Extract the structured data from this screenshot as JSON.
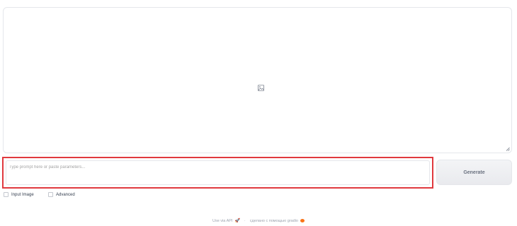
{
  "output": {
    "image_icon": "image-placeholder-icon",
    "resize_icon": "resize-handle-icon"
  },
  "prompt": {
    "placeholder": "Type prompt here or paste parameters..."
  },
  "generate": {
    "label": "Generate"
  },
  "options": {
    "input_image_label": "Input Image",
    "advanced_label": "Advanced"
  },
  "footer": {
    "api_label": "Use via API",
    "separator": "·",
    "made_with": "сделано с помощью gradio",
    "api_icon": "rocket-icon",
    "gradio_icon": "gradio-logo-icon"
  },
  "colors": {
    "highlight_border": "#e0393e",
    "button_bg": "#f3f4f6"
  }
}
